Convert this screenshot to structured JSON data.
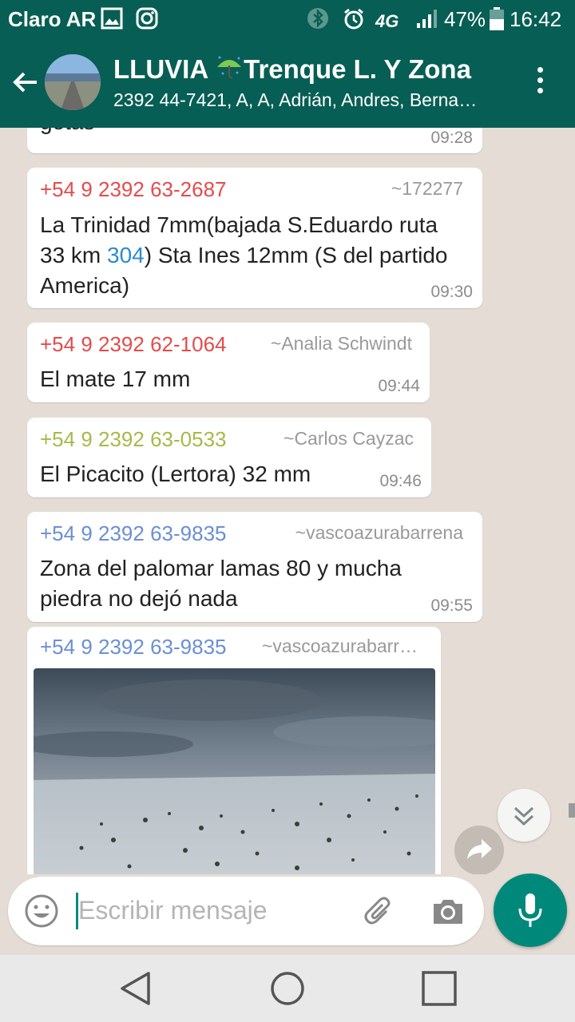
{
  "status_bar": {
    "carrier": "Claro AR",
    "network": "4G",
    "battery": "47%",
    "time": "16:42",
    "icons": [
      "gallery-icon",
      "instagram-icon",
      "bluetooth-icon",
      "alarm-icon",
      "signal-icon",
      "battery-icon"
    ]
  },
  "header": {
    "title_start": "LLUVIA ",
    "title_end": "Trenque L. Y Zona",
    "subtitle": "2392 44-7421, A, A, Adrián, Andres, Berna…",
    "icons": [
      "back-arrow-icon",
      "group-avatar",
      "umbrella-rain-emoji",
      "more-vert-icon"
    ]
  },
  "messages": [
    {
      "sender": "",
      "alias": "",
      "text": "gotas",
      "time": "09:28"
    },
    {
      "sender": "+54 9 2392 63-2687",
      "alias": "~172277",
      "text_before": "La Trinidad 7mm(bajada S.Eduardo ruta 33   km ",
      "link": "304",
      "text_after": ") Sta Ines 12mm (S del partido America)",
      "time": "09:30"
    },
    {
      "sender": "+54 9 2392 62-1064",
      "alias": "~Analia Schwindt",
      "text": "El mate 17 mm",
      "time": "09:44"
    },
    {
      "sender": "+54 9 2392 63-0533",
      "alias": "~Carlos Cayzac",
      "text": "El Picacito (Lertora) 32 mm",
      "time": "09:46"
    },
    {
      "sender": "+54 9 2392 63-9835",
      "alias": "~vascoazurabarrena",
      "text": "Zona del palomar lamas 80 y mucha piedra no dejó nada",
      "time": "09:55"
    },
    {
      "sender": "+54 9 2392 63-9835",
      "alias": "~vascoazurabarr…",
      "image": "hail-covered-field-photo"
    }
  ],
  "sender_colors": {
    "red": "#e54b4b",
    "olive": "#a8b84a",
    "blue": "#6a8fd6"
  },
  "input": {
    "placeholder": "Escribir mensaje",
    "icons": [
      "emoji-icon",
      "attach-icon",
      "camera-icon",
      "mic-icon"
    ]
  },
  "fab_icons": [
    "scroll-down-icon",
    "forward-icon"
  ],
  "nav": [
    "back-nav-icon",
    "home-nav-icon",
    "recents-nav-icon"
  ],
  "colors": {
    "header": "#075e54",
    "chat_bg": "#e5ddd5",
    "accent": "#00897b"
  }
}
